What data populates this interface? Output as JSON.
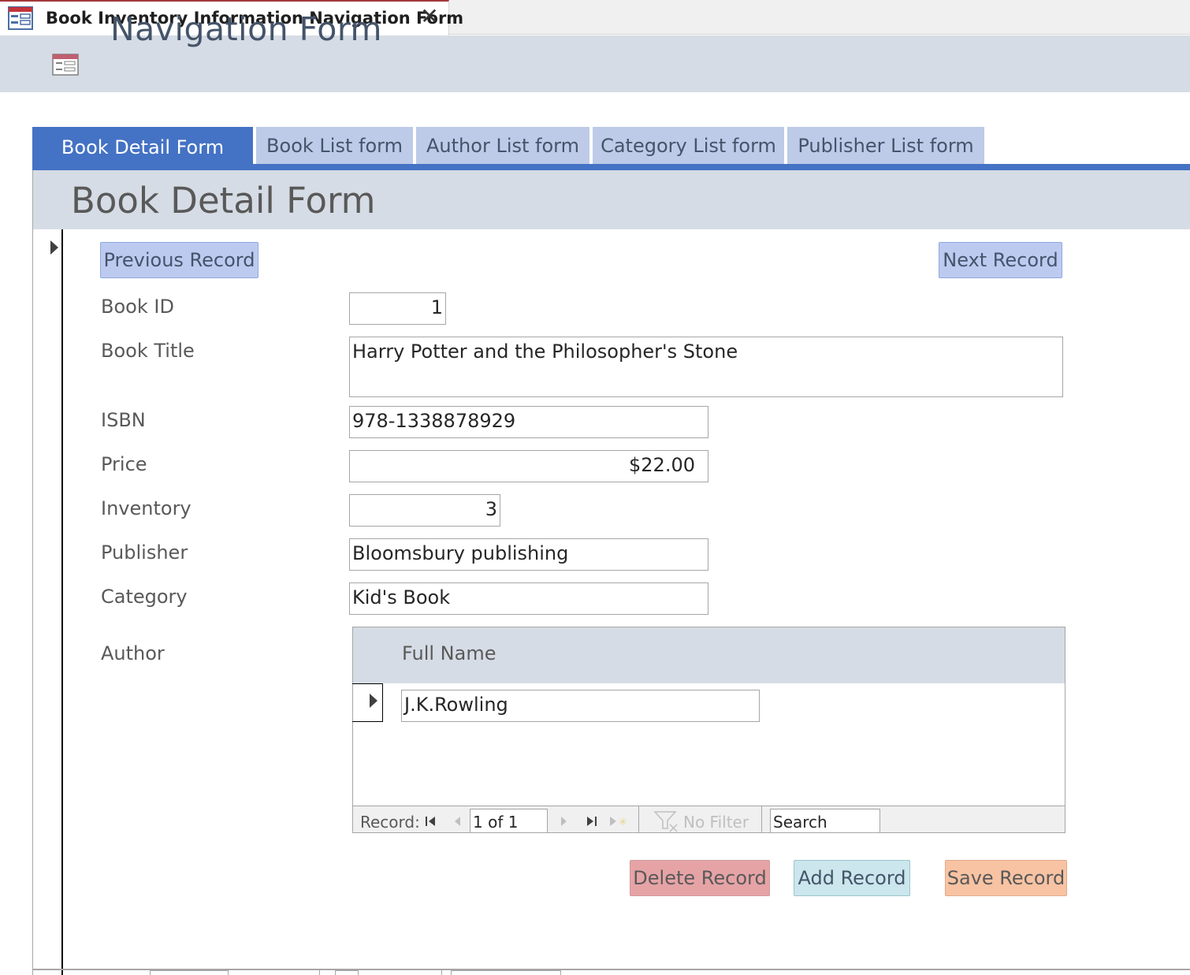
{
  "window": {
    "tab_title": "Book Inventory Information Navigation Form",
    "close_glyph": "✕"
  },
  "header": {
    "title": "Navigation Form",
    "icon": "form-icon"
  },
  "nav_tabs": [
    {
      "label": "Book Detail Form",
      "active": true
    },
    {
      "label": "Book List form",
      "active": false
    },
    {
      "label": "Author List form",
      "active": false
    },
    {
      "label": "Category List form",
      "active": false
    },
    {
      "label": "Publisher List form",
      "active": false
    }
  ],
  "subform": {
    "title": "Book Detail Form",
    "previous_label": "Previous Record",
    "next_label": "Next Record",
    "fields": {
      "book_id": {
        "label": "Book ID",
        "value": "1"
      },
      "book_title": {
        "label": "Book Title",
        "value": "Harry Potter and the Philosopher's Stone"
      },
      "isbn": {
        "label": "ISBN",
        "value": "978-1338878929"
      },
      "price": {
        "label": "Price",
        "value": "$22.00"
      },
      "inventory": {
        "label": "Inventory",
        "value": "3"
      },
      "publisher": {
        "label": "Publisher",
        "value": "Bloomsbury publishing"
      },
      "category": {
        "label": "Category",
        "value": "Kid's Book"
      },
      "author": {
        "label": "Author"
      }
    },
    "author_subform": {
      "column_header": "Full Name",
      "rows": [
        "J.K.Rowling"
      ],
      "navigation": {
        "record_label": "Record:",
        "position": "1 of 1",
        "filter_label": "No Filter",
        "search_placeholder": "Search"
      }
    },
    "actions": {
      "delete_label": "Delete Record",
      "add_label": "Add Record",
      "save_label": "Save Record"
    }
  },
  "colors": {
    "accent": "#4472c4",
    "tab_inactive": "#bdcae8",
    "header_bg": "#d6dce5",
    "delete_bg": "#e6a3a6",
    "add_bg": "#cbe6ec",
    "save_bg": "#f8c3a3"
  }
}
